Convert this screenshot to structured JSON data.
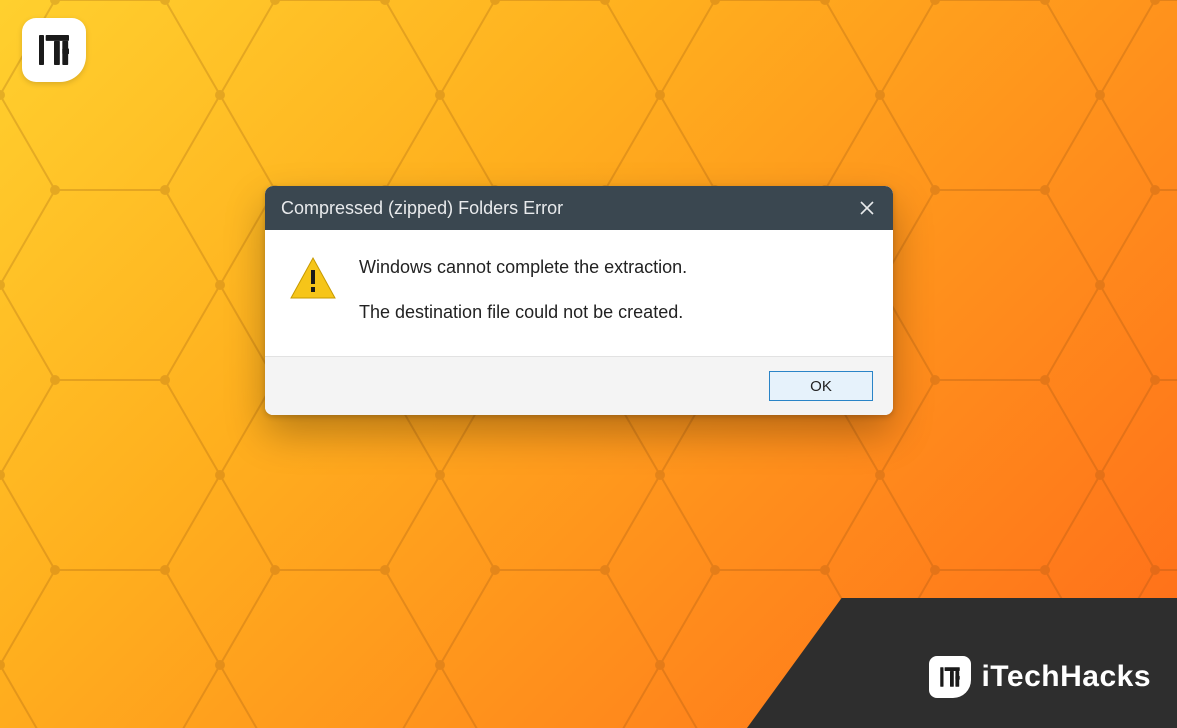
{
  "dialog": {
    "title": "Compressed (zipped) Folders Error",
    "message_line1": "Windows cannot complete the extraction.",
    "message_line2": "The destination file could not be created.",
    "ok_label": "OK"
  },
  "branding": {
    "site_name": "iTechHacks"
  },
  "colors": {
    "titlebar_bg": "#3a4750",
    "accent_button_border": "#2a84c7",
    "warning_yellow": "#f6c519"
  }
}
